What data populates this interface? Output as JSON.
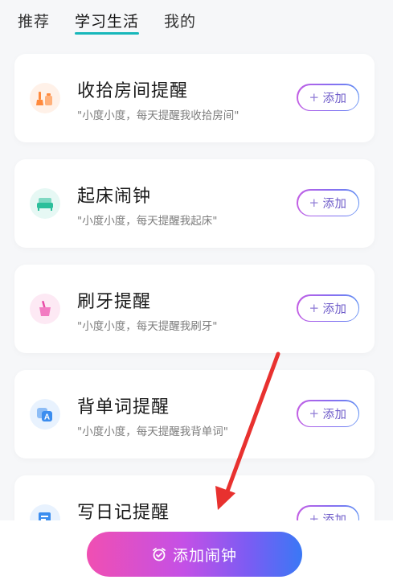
{
  "tabs": [
    {
      "label": "推荐"
    },
    {
      "label": "学习生活"
    },
    {
      "label": "我的"
    }
  ],
  "add_button": {
    "label": "添加"
  },
  "cards": [
    {
      "title": "收拾房间提醒",
      "subtitle": "\"小度小度，每天提醒我收拾房间\"",
      "icon": "broom-icon",
      "icon_bg": "#fff1e8",
      "icon_color": "#ff8a3d"
    },
    {
      "title": "起床闹钟",
      "subtitle": "\"小度小度，每天提醒我起床\"",
      "icon": "bed-icon",
      "icon_bg": "#e6f8f4",
      "icon_color": "#2bbf9b"
    },
    {
      "title": "刷牙提醒",
      "subtitle": "\"小度小度，每天提醒我刷牙\"",
      "icon": "toothbrush-cup-icon",
      "icon_bg": "#fde9f4",
      "icon_color": "#e84aa6"
    },
    {
      "title": "背单词提醒",
      "subtitle": "\"小度小度，每天提醒我背单词\"",
      "icon": "vocabulary-icon",
      "icon_bg": "#e8f2fe",
      "icon_color": "#3b8def"
    },
    {
      "title": "写日记提醒",
      "subtitle": "",
      "icon": "diary-icon",
      "icon_bg": "#e8f2fe",
      "icon_color": "#3b8def"
    }
  ],
  "bottom": {
    "button_label": "添加闹钟"
  },
  "colors": {
    "tab_underline": "#17b7ba",
    "arrow": "#e8312f"
  }
}
